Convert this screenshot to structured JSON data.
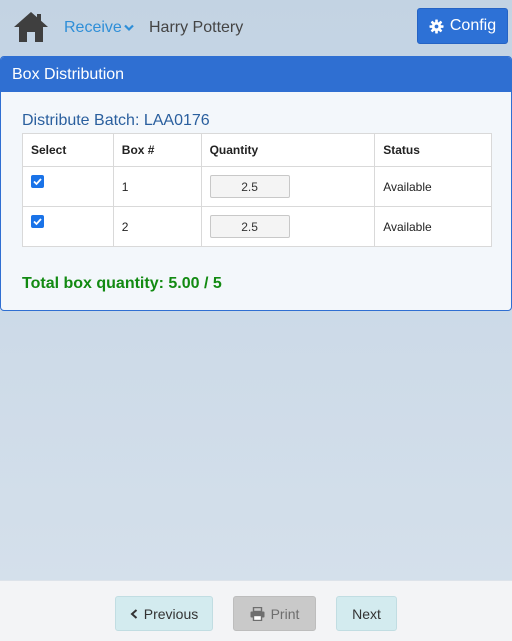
{
  "header": {
    "home_icon": "home-icon",
    "receive_label": "Receive",
    "user_name": "Harry Pottery",
    "config_label": "Config"
  },
  "panel": {
    "title": "Box Distribution",
    "batch_title": "Distribute Batch: LAA0176",
    "columns": [
      "Select",
      "Box #",
      "Quantity",
      "Status"
    ],
    "rows": [
      {
        "selected": true,
        "box": "1",
        "quantity": "2.5",
        "status": "Available"
      },
      {
        "selected": true,
        "box": "2",
        "quantity": "2.5",
        "status": "Available"
      }
    ],
    "total_text": "Total box quantity: 5.00 / 5"
  },
  "footer": {
    "previous_label": "Previous",
    "print_label": "Print",
    "next_label": "Next"
  },
  "colors": {
    "accent": "#2f6fd2",
    "link": "#2f8fd8",
    "total_green": "#128a12",
    "checkbox": "#1a73e8"
  }
}
